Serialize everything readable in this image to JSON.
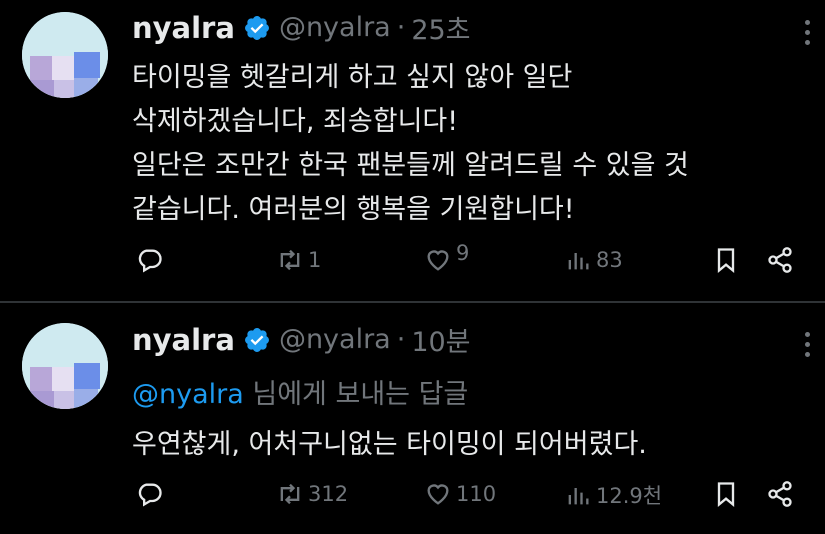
{
  "tweets": [
    {
      "name": "nyalra",
      "handle": "@nyalra",
      "dot": "·",
      "time": "25초",
      "lines": [
        "타이밍을 헷갈리게 하고 싶지 않아 일단",
        "삭제하겠습니다, 죄송합니다!",
        "일단은 조만간 한국 팬분들께 알려드릴 수 있을 것",
        "같습니다. 여러분의 행복을 기원합니다!"
      ],
      "retweets": "1",
      "likes": "9",
      "views": "83"
    },
    {
      "name": "nyalra",
      "handle": "@nyalra",
      "dot": "·",
      "time": "10분",
      "reply_mention": "@nyalra",
      "reply_suffix": " 님에게 보내는 답글",
      "text": "우연찮게, 어처구니없는 타이밍이 되어버렸다.",
      "retweets": "312",
      "likes": "110",
      "views": "12.9천"
    }
  ],
  "colors": {
    "background": "#000000",
    "text": "#e7e9ea",
    "muted": "#71767b",
    "accent": "#1d9bf0",
    "avatar_bg": "#c9e6ec"
  },
  "icons": [
    "verified-badge-icon",
    "more-icon",
    "reply-icon",
    "retweet-icon",
    "like-icon",
    "views-icon",
    "bookmark-icon",
    "share-icon"
  ]
}
